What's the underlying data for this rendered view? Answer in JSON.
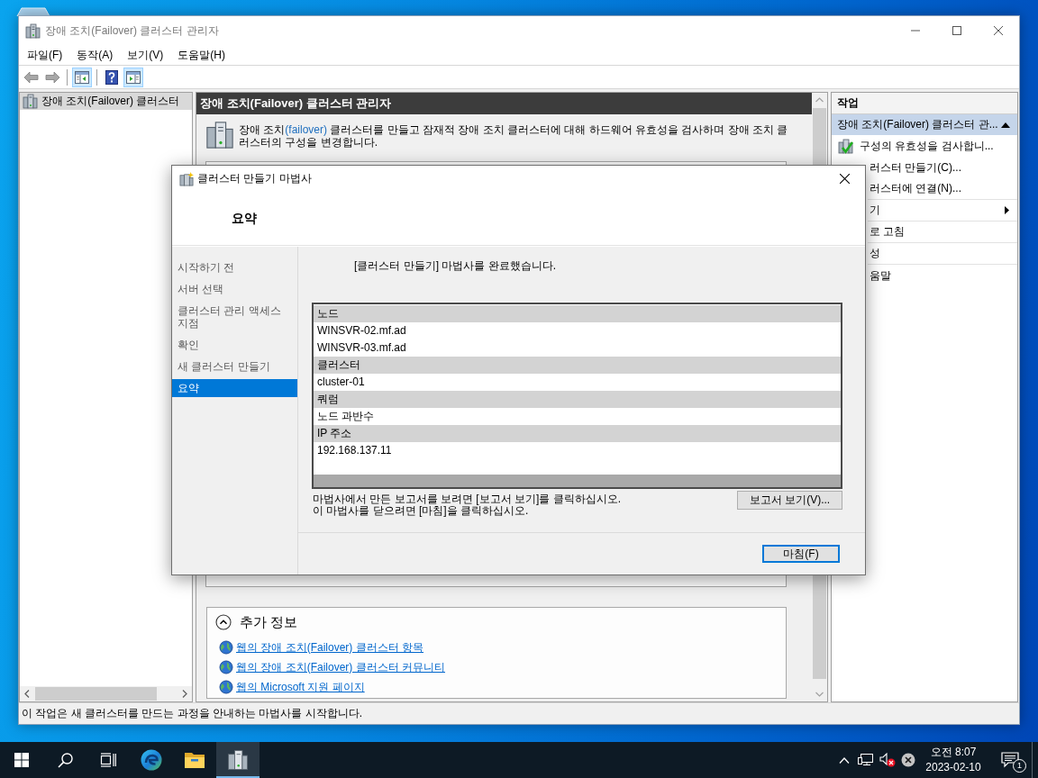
{
  "window": {
    "title": "장애 조치(Failover) 클러스터 관리자",
    "menu": [
      "파일(F)",
      "동작(A)",
      "보기(V)",
      "도움말(H)"
    ],
    "toolbar": [
      [
        {
          "kind": "back",
          "pressed": false,
          "disabled": true
        },
        {
          "kind": "forward",
          "pressed": false,
          "disabled": true
        }
      ],
      [
        {
          "kind": "console-tree",
          "pressed": true,
          "disabled": false
        }
      ],
      [
        {
          "kind": "help",
          "pressed": false,
          "disabled": false
        },
        {
          "kind": "action-pane",
          "pressed": true,
          "disabled": false
        }
      ]
    ]
  },
  "tree": {
    "items": [
      {
        "label": "장애 조치(Failover) 클러스터",
        "selected": true
      }
    ]
  },
  "center": {
    "header": "장애 조치(Failover) 클러스터 관리자",
    "description": [
      {
        "text": "장애 조치",
        "highlight": false
      },
      {
        "text": "(failover)",
        "highlight": true
      },
      {
        "text": " 클러스터를 만들고 잠재적 장애 조치 클러스터에 대해 하드웨어 유효성을 검사하며 장애 조치 클러스터의 구성을 변경합니다.",
        "highlight": false
      }
    ],
    "more_info": {
      "title": "추가 정보",
      "expanded": true,
      "links": [
        "웹의 장애 조치(Failover) 클러스터 항목",
        "웹의 장애 조치(Failover) 클러스터 커뮤니티",
        "웹의 Microsoft 지원 페이지"
      ]
    }
  },
  "actions": {
    "title": "작업",
    "group": {
      "label": "장애 조치(Failover) 클러스터 관...",
      "expanded": true
    },
    "items": [
      {
        "label": "구성의 유효성을 검사합니...",
        "kind": "full",
        "submenu": false,
        "divider": false
      },
      {
        "label": "러스터 만들기(C)...",
        "kind": "partial",
        "submenu": false,
        "divider": false
      },
      {
        "label": "러스터에 연결(N)...",
        "kind": "partial",
        "submenu": false,
        "divider": true
      },
      {
        "label": "기",
        "kind": "partial",
        "submenu": true,
        "divider": true
      },
      {
        "label": "로 고침",
        "kind": "partial",
        "submenu": false,
        "divider": true
      },
      {
        "label": "성",
        "kind": "partial",
        "submenu": false,
        "divider": true
      },
      {
        "label": "움말",
        "kind": "partial",
        "submenu": false,
        "divider": false
      }
    ]
  },
  "status_bar": "이 작업은 새 클러스터를 만드는 과정을 안내하는 마법사를 시작합니다.",
  "dialog": {
    "title": "클러스터 만들기 마법사",
    "heading": "요약",
    "steps": [
      {
        "label": "시작하기 전",
        "selected": false
      },
      {
        "label": "서버 선택",
        "selected": false
      },
      {
        "label": "클러스터 관리 액세스 지점",
        "selected": false
      },
      {
        "label": "확인",
        "selected": false
      },
      {
        "label": "새 클러스터 만들기",
        "selected": false
      },
      {
        "label": "요약",
        "selected": true
      }
    ],
    "message": "[클러스터 만들기] 마법사를 완료했습니다.",
    "summary": [
      {
        "heading": "노드",
        "values": [
          "WINSVR-02.mf.ad",
          "WINSVR-03.mf.ad"
        ]
      },
      {
        "heading": "클러스터",
        "values": [
          "cluster-01"
        ]
      },
      {
        "heading": "쿼럼",
        "values": [
          "노드 과반수"
        ]
      },
      {
        "heading": "IP 주소",
        "values": [
          "192.168.137.11"
        ]
      }
    ],
    "notes": [
      "마법사에서 만든 보고서를 보려면 [보고서 보기]를 클릭하십시오.",
      "이 마법사를 닫으려면 [마침]을 클릭하십시오."
    ],
    "report_button": "보고서 보기(V)...",
    "finish_button": "마침(F)"
  },
  "taskbar": {
    "apps": [
      {
        "kind": "start",
        "selected": false
      },
      {
        "kind": "search",
        "selected": false
      },
      {
        "kind": "task-view",
        "selected": false
      },
      {
        "kind": "browser",
        "selected": false
      },
      {
        "kind": "folder",
        "selected": false
      },
      {
        "kind": "cluster-manager",
        "selected": true
      }
    ],
    "clock": {
      "time": "오전 8:07",
      "date": "2023-02-10"
    },
    "notification_count": "1"
  }
}
